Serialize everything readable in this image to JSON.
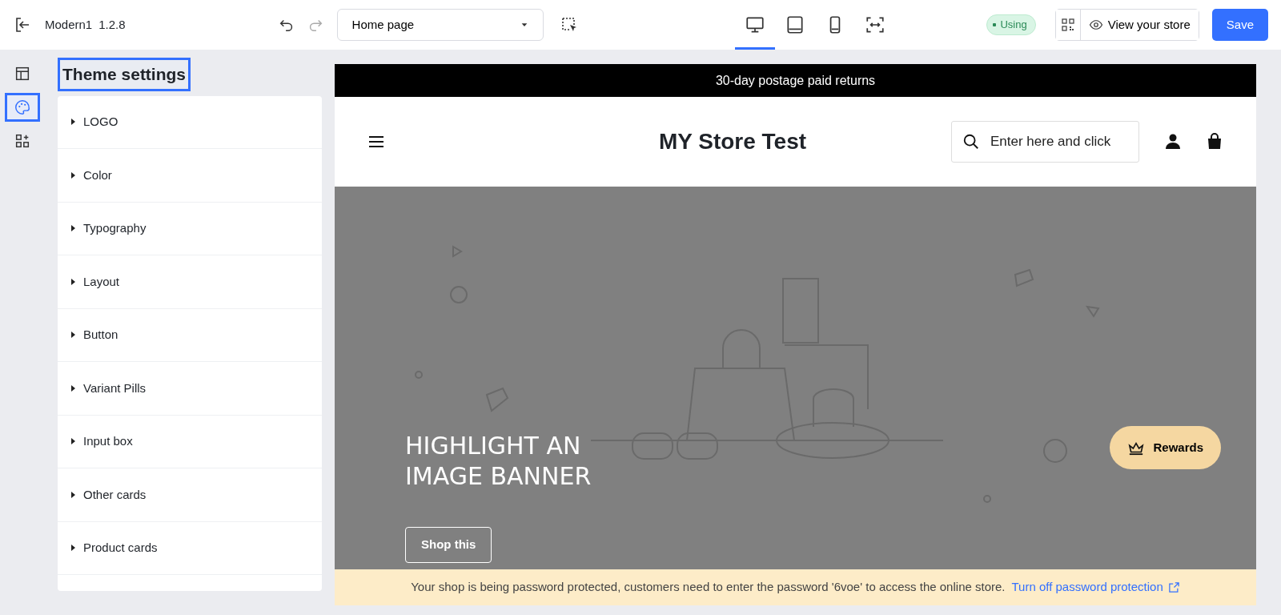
{
  "topbar": {
    "theme_name": "Modern1",
    "version": "1.2.8",
    "page_select": "Home page",
    "device_tabs": [
      {
        "kind": "desktop",
        "selected": true
      },
      {
        "kind": "tablet",
        "selected": false
      },
      {
        "kind": "mobile",
        "selected": false
      },
      {
        "kind": "fit",
        "selected": false
      }
    ],
    "status_badge": "Using",
    "view_store": "View your store",
    "save": "Save"
  },
  "rail": [
    {
      "kind": "sections",
      "selected": false
    },
    {
      "kind": "theme",
      "selected": true
    },
    {
      "kind": "apps",
      "selected": false
    }
  ],
  "settings": {
    "title": "Theme settings",
    "items": [
      {
        "label": "LOGO"
      },
      {
        "label": "Color"
      },
      {
        "label": "Typography"
      },
      {
        "label": "Layout"
      },
      {
        "label": "Button"
      },
      {
        "label": "Variant Pills"
      },
      {
        "label": "Input box"
      },
      {
        "label": "Other cards"
      },
      {
        "label": "Product cards"
      }
    ]
  },
  "preview": {
    "announcement": "30-day postage paid returns",
    "store_title": "MY Store Test",
    "search": {
      "placeholder": "Enter here and click"
    },
    "banner": {
      "kind": "picture",
      "heading_lines": [
        "HIGHLIGHT AN",
        "IMAGE BANNER"
      ],
      "button": "Shop this"
    },
    "rewards": "Rewards",
    "notice": {
      "text": "Your shop is being password protected, customers need to enter the password '6voe' to access the online store.",
      "link": "Turn off password protection"
    }
  }
}
